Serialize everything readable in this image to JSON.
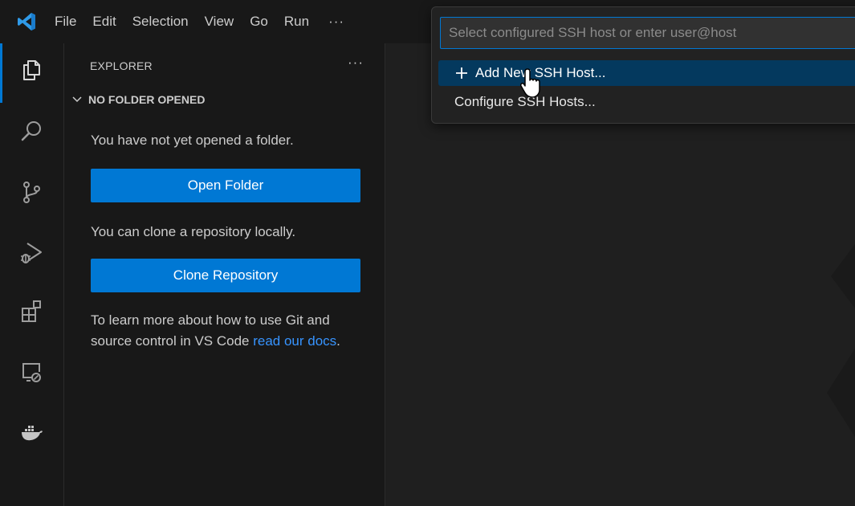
{
  "menu": {
    "items": [
      "File",
      "Edit",
      "Selection",
      "View",
      "Go",
      "Run"
    ],
    "more": "···"
  },
  "activity_bar": {
    "icons": [
      "explorer-icon",
      "search-icon",
      "source-control-icon",
      "run-debug-icon",
      "extensions-icon",
      "remote-explorer-icon",
      "docker-icon"
    ]
  },
  "sidebar": {
    "title": "EXPLORER",
    "more": "···",
    "section_title": "NO FOLDER OPENED",
    "no_folder_text": "You have not yet opened a folder.",
    "open_folder_label": "Open Folder",
    "clone_text": "You can clone a repository locally.",
    "clone_label": "Clone Repository",
    "learn_text": "To learn more about how to use Git and source control in VS Code ",
    "learn_link": "read our docs",
    "learn_end": "."
  },
  "quick_pick": {
    "placeholder": "Select configured SSH host or enter user@host",
    "items": [
      {
        "label": "Add New SSH Host...",
        "icon": "plus-icon",
        "selected": true
      },
      {
        "label": "Configure SSH Hosts...",
        "selected": false
      }
    ]
  },
  "colors": {
    "accent": "#0078d4",
    "link": "#3794ff",
    "selection": "#04395e"
  }
}
